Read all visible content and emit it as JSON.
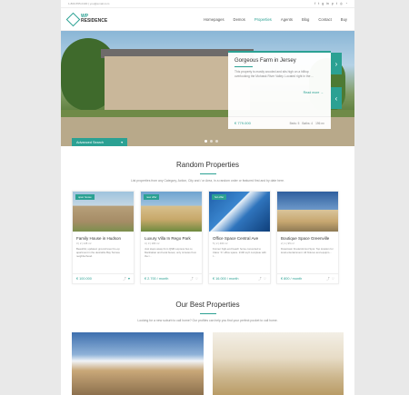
{
  "topbar": {
    "contact": "1-800-555-0100  |  you@email.com",
    "social_icons": [
      "facebook-icon",
      "twitter-icon",
      "google-plus-icon",
      "linkedin-icon",
      "pinterest-icon",
      "tumblr-icon",
      "instagram-icon",
      "rss-icon"
    ]
  },
  "logo": {
    "line1": "WP",
    "line2": "RESIDENCE"
  },
  "nav": [
    "Homepages",
    "Demos",
    "Properties",
    "Agents",
    "Blog",
    "Contact",
    "Buy"
  ],
  "hero": {
    "card_title": "Gorgeous Farm in Jersey",
    "card_text": "This property is mostly wooded and sits high on a hilltop overlooking the Mohawk River Valley. Located right in the ...",
    "read_more": "Read more →",
    "price": "€ 779.000",
    "facts": [
      "Beds: 5",
      "Baths: 4",
      "196 m²"
    ],
    "advanced_search": "Advanced Search"
  },
  "random": {
    "title": "Random Properties",
    "subtitle": "List properties from any Category, Action, City and / or Area, in a random order or featured first and by date here.",
    "items": [
      {
        "tag": "open house",
        "title": "Family House in Hudson",
        "meta": "3  |  2  |  145 m²",
        "desc": "Beautiful, updated, ground level Co-op apartment in the desirable Bay Terrace neighborhood.",
        "price": "€ 100.000"
      },
      {
        "tag": "new offer",
        "title": "Luxury Villa In Rego Park",
        "meta": "4  |  3  |  180 m²",
        "desc": "Just steps away from QMD express bus to Manhattan and local buses; only minutes from the I...",
        "price": "€ 2.700 / month"
      },
      {
        "tag": "hot offer",
        "title": "Office Space Central Ave",
        "meta": "5  |  2  |  400 m²",
        "desc": "Former high-end beach home converted to Class “A” office space. 2100 sq ft complete with l...",
        "price": "€ 16.000 / month"
      },
      {
        "tag": "",
        "title": "Boutique Space Greenville",
        "meta": "2  |  1  |  95 m²",
        "desc": "Downtown Frederick Hot Spot. Top location for local entertainment. All fixtures and equipm...",
        "price": "€ 800 / month"
      }
    ]
  },
  "best": {
    "title": "Our Best Properties",
    "subtitle": "Looking for a new suburb to call home? Our profiles can help you find your perfect pocket to call home."
  },
  "colors": {
    "accent": "#2ba193"
  }
}
